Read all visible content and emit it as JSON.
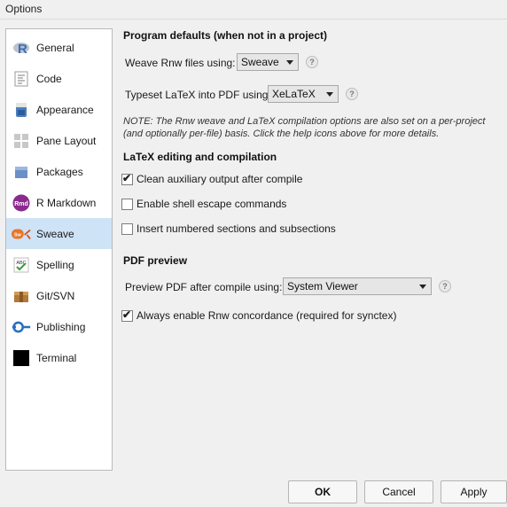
{
  "window": {
    "title": "Options"
  },
  "sidebar": {
    "items": [
      {
        "label": "General",
        "icon": "r-logo-icon"
      },
      {
        "label": "Code",
        "icon": "code-icon"
      },
      {
        "label": "Appearance",
        "icon": "appearance-icon"
      },
      {
        "label": "Pane Layout",
        "icon": "pane-layout-icon"
      },
      {
        "label": "Packages",
        "icon": "packages-icon"
      },
      {
        "label": "R Markdown",
        "icon": "rmd-icon",
        "icon_text": "Rmd"
      },
      {
        "label": "Sweave",
        "icon": "sweave-icon",
        "icon_text": "Sw",
        "selected": true
      },
      {
        "label": "Spelling",
        "icon": "spelling-icon",
        "icon_text": "ABC"
      },
      {
        "label": "Git/SVN",
        "icon": "git-icon"
      },
      {
        "label": "Publishing",
        "icon": "publishing-icon"
      },
      {
        "label": "Terminal",
        "icon": "terminal-icon"
      }
    ]
  },
  "program_defaults": {
    "heading": "Program defaults (when not in a project)",
    "weave_label": "Weave Rnw files using:",
    "weave_value": "Sweave",
    "typeset_label": "Typeset LaTeX into PDF using:",
    "typeset_value": "XeLaTeX",
    "help_glyph": "?",
    "note": "NOTE: The Rnw weave and LaTeX compilation options are also set on a per-project (and optionally per-file) basis. Click the help icons above for more details."
  },
  "latex_editing": {
    "heading": "LaTeX editing and compilation",
    "options": [
      {
        "label": "Clean auxiliary output after compile",
        "checked": true
      },
      {
        "label": "Enable shell escape commands",
        "checked": false
      },
      {
        "label": "Insert numbered sections and subsections",
        "checked": false
      }
    ]
  },
  "pdf_preview": {
    "heading": "PDF preview",
    "preview_label": "Preview PDF after compile using:",
    "preview_value": "System Viewer",
    "concordance_label": "Always enable Rnw concordance (required for synctex)",
    "concordance_checked": true
  },
  "buttons": {
    "ok": "OK",
    "cancel": "Cancel",
    "apply": "Apply"
  },
  "check_glyph": "✔",
  "colors": {
    "selection": "#cfe3f7",
    "rmd": "#8b2a8f",
    "sweave": "#e8752a",
    "publishing": "#2a6fbf"
  }
}
